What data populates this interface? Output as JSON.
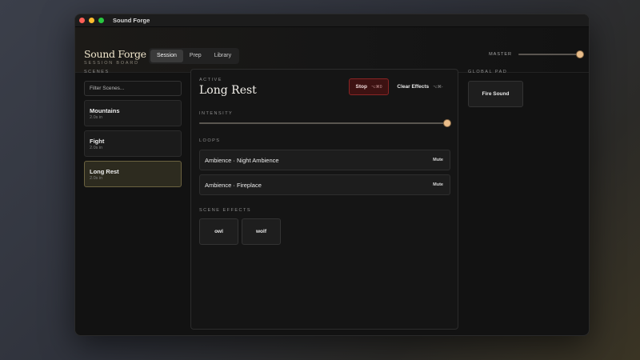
{
  "window": {
    "title": "Sound Forge"
  },
  "header": {
    "brand_name": "Sound Forge",
    "brand_sub": "SESSION BOARD",
    "tabs": [
      {
        "label": "Session",
        "active": true
      },
      {
        "label": "Prep",
        "active": false
      },
      {
        "label": "Library",
        "active": false
      }
    ],
    "master_label": "MASTER",
    "master_value": 1.0
  },
  "sidebar": {
    "label": "SCENES",
    "filter_placeholder": "Filter Scenes...",
    "scenes": [
      {
        "name": "Mountains",
        "meta": "2.0s in",
        "active": false
      },
      {
        "name": "Fight",
        "meta": "2.0s in",
        "active": false
      },
      {
        "name": "Long Rest",
        "meta": "2.0s in",
        "active": true
      }
    ]
  },
  "main": {
    "active_label": "ACTIVE",
    "active_title": "Long Rest",
    "stop_label": "Stop",
    "stop_shortcut": "⌥⌘0",
    "clear_label": "Clear Effects",
    "clear_shortcut": "⌥⌘-",
    "intensity_label": "INTENSITY",
    "intensity_value": 1.0,
    "loops_label": "LOOPS",
    "loops": [
      {
        "name": "Ambience · Night Ambience",
        "mute_label": "Mute"
      },
      {
        "name": "Ambience · Fireplace",
        "mute_label": "Mute"
      }
    ],
    "effects_label": "SCENE EFFECTS",
    "effects": [
      {
        "label": "owl"
      },
      {
        "label": "wolf"
      }
    ]
  },
  "global_pad": {
    "label": "GLOBAL PAD",
    "button_label": "Fire Sound"
  },
  "colors": {
    "accent": "#e9bd8a",
    "stop_bg": "#3d1212",
    "active_scene_bg": "#2d2b1f"
  }
}
